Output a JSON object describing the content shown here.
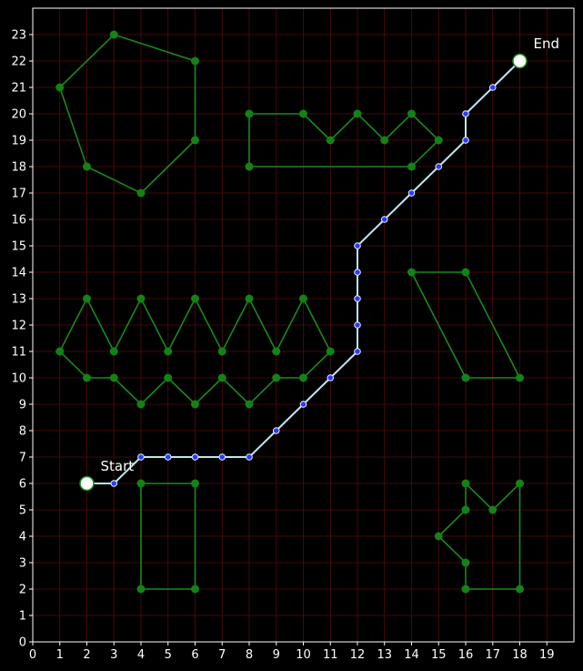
{
  "colors": {
    "background": "#000000",
    "grid": "#5a0a0a",
    "frame": "#ffffff",
    "obstacle": "#1a8a1a",
    "obstacle_vertex": "#148214",
    "path_line": "#bfe6f0",
    "path_node_fill": "#2b3bff",
    "path_node_edge": "#e6f4ff",
    "endpoint_fill": "#ffffff",
    "endpoint_edge": "#1a8a1a",
    "text": "#ffffff"
  },
  "annotations": {
    "start_label": "Start",
    "end_label": "End"
  },
  "chart_data": {
    "type": "scatter",
    "xlim": [
      0,
      20
    ],
    "ylim": [
      0,
      24
    ],
    "grid": true,
    "x_ticks": [
      0,
      1,
      2,
      3,
      4,
      5,
      6,
      7,
      8,
      9,
      10,
      11,
      12,
      13,
      14,
      15,
      16,
      17,
      18,
      19
    ],
    "y_ticks": [
      0,
      1,
      2,
      3,
      4,
      5,
      6,
      7,
      8,
      9,
      10,
      11,
      12,
      13,
      14,
      15,
      16,
      17,
      18,
      19,
      20,
      21,
      22,
      23
    ],
    "start": [
      2,
      6
    ],
    "end": [
      18,
      22
    ],
    "path": [
      [
        2,
        6
      ],
      [
        3,
        6
      ],
      [
        4,
        7
      ],
      [
        5,
        7
      ],
      [
        6,
        7
      ],
      [
        7,
        7
      ],
      [
        8,
        7
      ],
      [
        9,
        8
      ],
      [
        10,
        9
      ],
      [
        11,
        10
      ],
      [
        12,
        11
      ],
      [
        12,
        12
      ],
      [
        12,
        13
      ],
      [
        12,
        14
      ],
      [
        12,
        15
      ],
      [
        13,
        16
      ],
      [
        14,
        17
      ],
      [
        15,
        18
      ],
      [
        16,
        19
      ],
      [
        16,
        20
      ],
      [
        17,
        21
      ],
      [
        18,
        22
      ]
    ],
    "obstacles": [
      [
        [
          1,
          21
        ],
        [
          3,
          23
        ],
        [
          6,
          22
        ],
        [
          6,
          19
        ],
        [
          4,
          17
        ],
        [
          2,
          18
        ]
      ],
      [
        [
          8,
          20
        ],
        [
          10,
          20
        ],
        [
          11,
          19
        ],
        [
          12,
          20
        ],
        [
          13,
          19
        ],
        [
          14,
          20
        ],
        [
          15,
          19
        ],
        [
          14,
          18
        ],
        [
          8,
          18
        ]
      ],
      [
        [
          1,
          11
        ],
        [
          2,
          13
        ],
        [
          3,
          11
        ],
        [
          4,
          13
        ],
        [
          5,
          11
        ],
        [
          6,
          13
        ],
        [
          7,
          11
        ],
        [
          8,
          13
        ],
        [
          9,
          11
        ],
        [
          10,
          13
        ],
        [
          11,
          11
        ],
        [
          10,
          10
        ],
        [
          9,
          10
        ],
        [
          8,
          9
        ],
        [
          7,
          10
        ],
        [
          6,
          9
        ],
        [
          5,
          10
        ],
        [
          4,
          9
        ],
        [
          3,
          10
        ],
        [
          2,
          10
        ]
      ],
      [
        [
          14,
          14
        ],
        [
          16,
          14
        ],
        [
          18,
          10
        ],
        [
          16,
          10
        ]
      ],
      [
        [
          4,
          6
        ],
        [
          6,
          6
        ],
        [
          6,
          2
        ],
        [
          4,
          2
        ]
      ],
      [
        [
          15,
          4
        ],
        [
          16,
          5
        ],
        [
          16,
          6
        ],
        [
          17,
          5
        ],
        [
          18,
          6
        ],
        [
          18,
          2
        ],
        [
          16,
          2
        ],
        [
          16,
          3
        ]
      ]
    ]
  }
}
